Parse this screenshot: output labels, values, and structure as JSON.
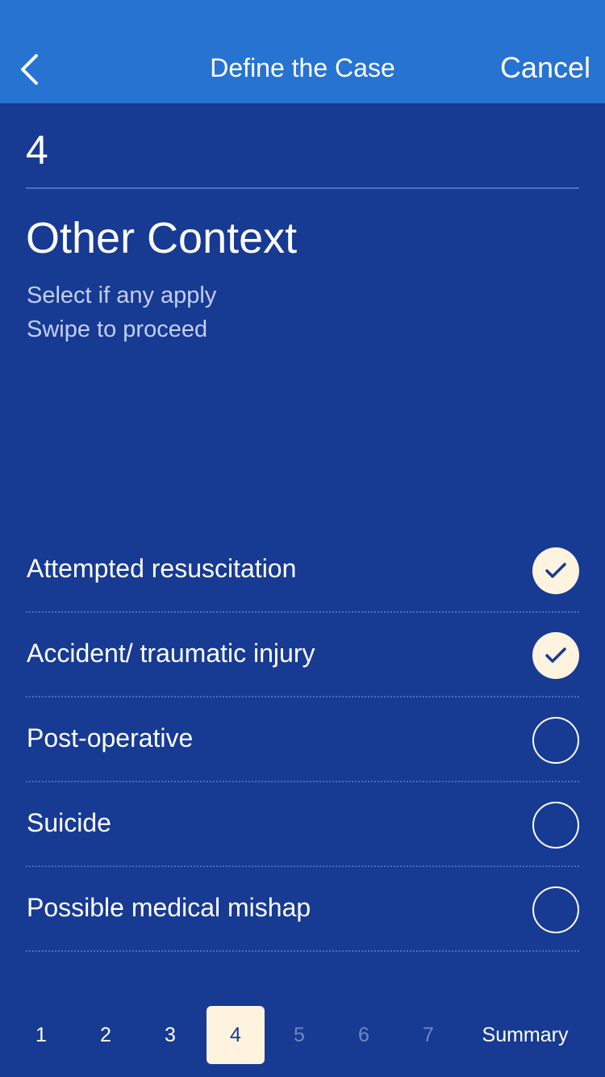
{
  "header": {
    "title": "Define the Case",
    "back_icon": "chevron-left-icon",
    "cancel_label": "Cancel"
  },
  "step": {
    "number": "4",
    "title": "Other Context",
    "instructions": [
      "Select if any apply",
      "Swipe to proceed"
    ]
  },
  "options": [
    {
      "label": "Attempted resuscitation",
      "checked": true
    },
    {
      "label": "Accident/ traumatic injury",
      "checked": true
    },
    {
      "label": "Post-operative",
      "checked": false
    },
    {
      "label": "Suicide",
      "checked": false
    },
    {
      "label": "Possible medical mishap",
      "checked": false
    }
  ],
  "pager": {
    "pages": [
      {
        "label": "1",
        "state": "enabled"
      },
      {
        "label": "2",
        "state": "enabled"
      },
      {
        "label": "3",
        "state": "enabled"
      },
      {
        "label": "4",
        "state": "active"
      },
      {
        "label": "5",
        "state": "disabled"
      },
      {
        "label": "6",
        "state": "disabled"
      },
      {
        "label": "7",
        "state": "disabled"
      }
    ],
    "summary_label": "Summary"
  },
  "colors": {
    "header_background": "#2673d2",
    "page_background": "#173a93",
    "accent_cream": "#fdf3df",
    "subtitle_text": "#c2cff0",
    "disabled_text": "#6f86c9"
  }
}
